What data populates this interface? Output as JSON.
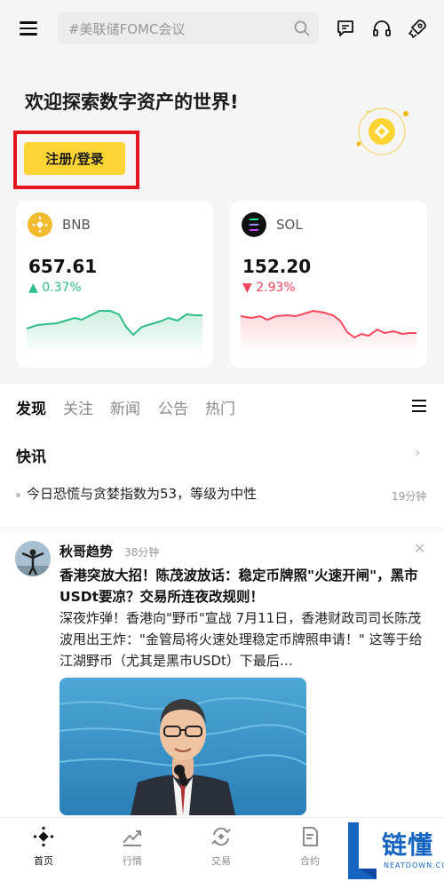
{
  "header": {
    "search_placeholder": "#美联储FOMC会议",
    "icons": [
      "menu-icon",
      "search-icon",
      "chat-icon",
      "headset-icon",
      "rocket-icon"
    ]
  },
  "welcome": {
    "title": "欢迎探索数字资产的世界!",
    "login_label": "注册/登录"
  },
  "coins": [
    {
      "name": "BNB",
      "price": "657.61",
      "change": "▲ 0.37%",
      "direction": "up",
      "color": "#2ebd85"
    },
    {
      "name": "SOL",
      "price": "152.20",
      "change": "▼ 2.93%",
      "direction": "down",
      "color": "#f6465d"
    }
  ],
  "tabs": [
    "发现",
    "关注",
    "新闻",
    "公告",
    "热门"
  ],
  "flash": {
    "title": "快讯",
    "items": [
      {
        "text": "今日恐慌与贪婪指数为53，等级为中性",
        "time": "19分钟"
      }
    ]
  },
  "post": {
    "author": "秋哥趋势",
    "time": "38分钟",
    "title": "香港突放大招！陈茂波放话：稳定币牌照\"火速开闸\"，黑市USDt要凉？交易所连夜改规则！",
    "body": "深夜炸弹！香港向\"野币\"宣战 7月11日，香港财政司司长陈茂波甩出王炸：\"金管局将火速处理稳定币牌照申请！\" 这等于给江湖野币（尤其是黑市USDt）下最后…"
  },
  "bottom_nav": [
    {
      "label": "首页",
      "icon": "home-icon",
      "active": true
    },
    {
      "label": "行情",
      "icon": "markets-icon",
      "active": false
    },
    {
      "label": "交易",
      "icon": "trade-icon",
      "active": false
    },
    {
      "label": "合约",
      "icon": "futures-icon",
      "active": false
    }
  ],
  "watermark": {
    "cn": "链懂",
    "en": "NEATDOWN.COM"
  },
  "colors": {
    "brand_yellow": "#fcd535",
    "up": "#2ebd85",
    "down": "#f6465d",
    "highlight": "#e4161d"
  }
}
